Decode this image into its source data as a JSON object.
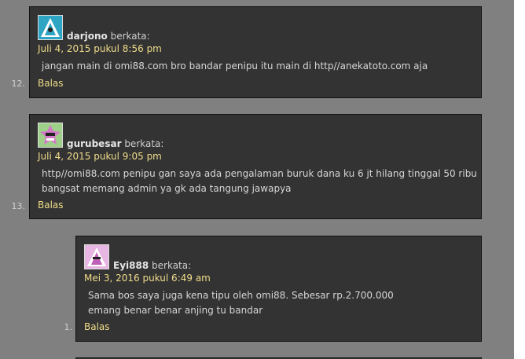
{
  "comments": [
    {
      "number": "12.",
      "author": "darjono",
      "says": "berkata:",
      "date": "Juli 4, 2015 pukul 8:56 pm",
      "lines": [
        "jangan main di omi88.com bro bandar penipu itu main di http//anekatoto.com aja"
      ],
      "reply": "Balas",
      "avatar_colors": {
        "bg": "#2fa5c4",
        "fg": "#ffffff"
      }
    },
    {
      "number": "13.",
      "author": "gurubesar",
      "says": "berkata:",
      "date": "Juli 4, 2015 pukul 9:05 pm",
      "lines": [
        "http//omi88.com penipu gan saya ada pengalaman buruk dana ku 6 jt hilang tinggal 50 ribu",
        "bangsat memang admin ya gk ada tangung jawapya"
      ],
      "reply": "Balas",
      "avatar_colors": {
        "bg": "#9fd08a",
        "fg": "#d478c8"
      }
    },
    {
      "number": "1.",
      "author": "Eyi888",
      "says": "berkata:",
      "date": "Mei 3, 2016 pukul 6:49 am",
      "lines": [
        "Sama bos saya juga kena tipu oleh omi88. Sebesar rp.2.700.000",
        "emang benar benar anjing tu bandar"
      ],
      "reply": "Balas",
      "avatar_colors": {
        "bg": "#e8b6e2",
        "fg": "#c060b8"
      }
    }
  ],
  "colors": {
    "page_bg": "#808080",
    "comment_bg": "#333333",
    "link": "#f0dc8a",
    "text": "#d6d6d6"
  }
}
